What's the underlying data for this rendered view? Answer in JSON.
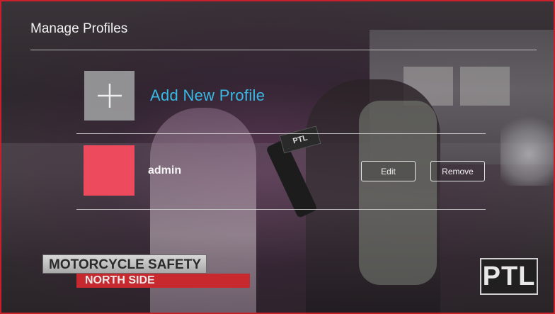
{
  "header": {
    "title": "Manage Profiles"
  },
  "add_profile": {
    "label": "Add New Profile",
    "icon": "plus-icon"
  },
  "profiles": [
    {
      "name": "admin",
      "avatar_color": "#ee4a5e",
      "edit_label": "Edit",
      "remove_label": "Remove"
    }
  ],
  "background": {
    "mic_flag": "PTL",
    "lower_third": {
      "headline": "MOTORCYCLE SAFETY",
      "subline": "NORTH SIDE"
    },
    "channel_logo": "PTL"
  },
  "colors": {
    "accent": "#38b9e6",
    "frame_border": "#c8202c",
    "avatar": "#ee4a5e",
    "lower_third_band": "#c7292e"
  }
}
